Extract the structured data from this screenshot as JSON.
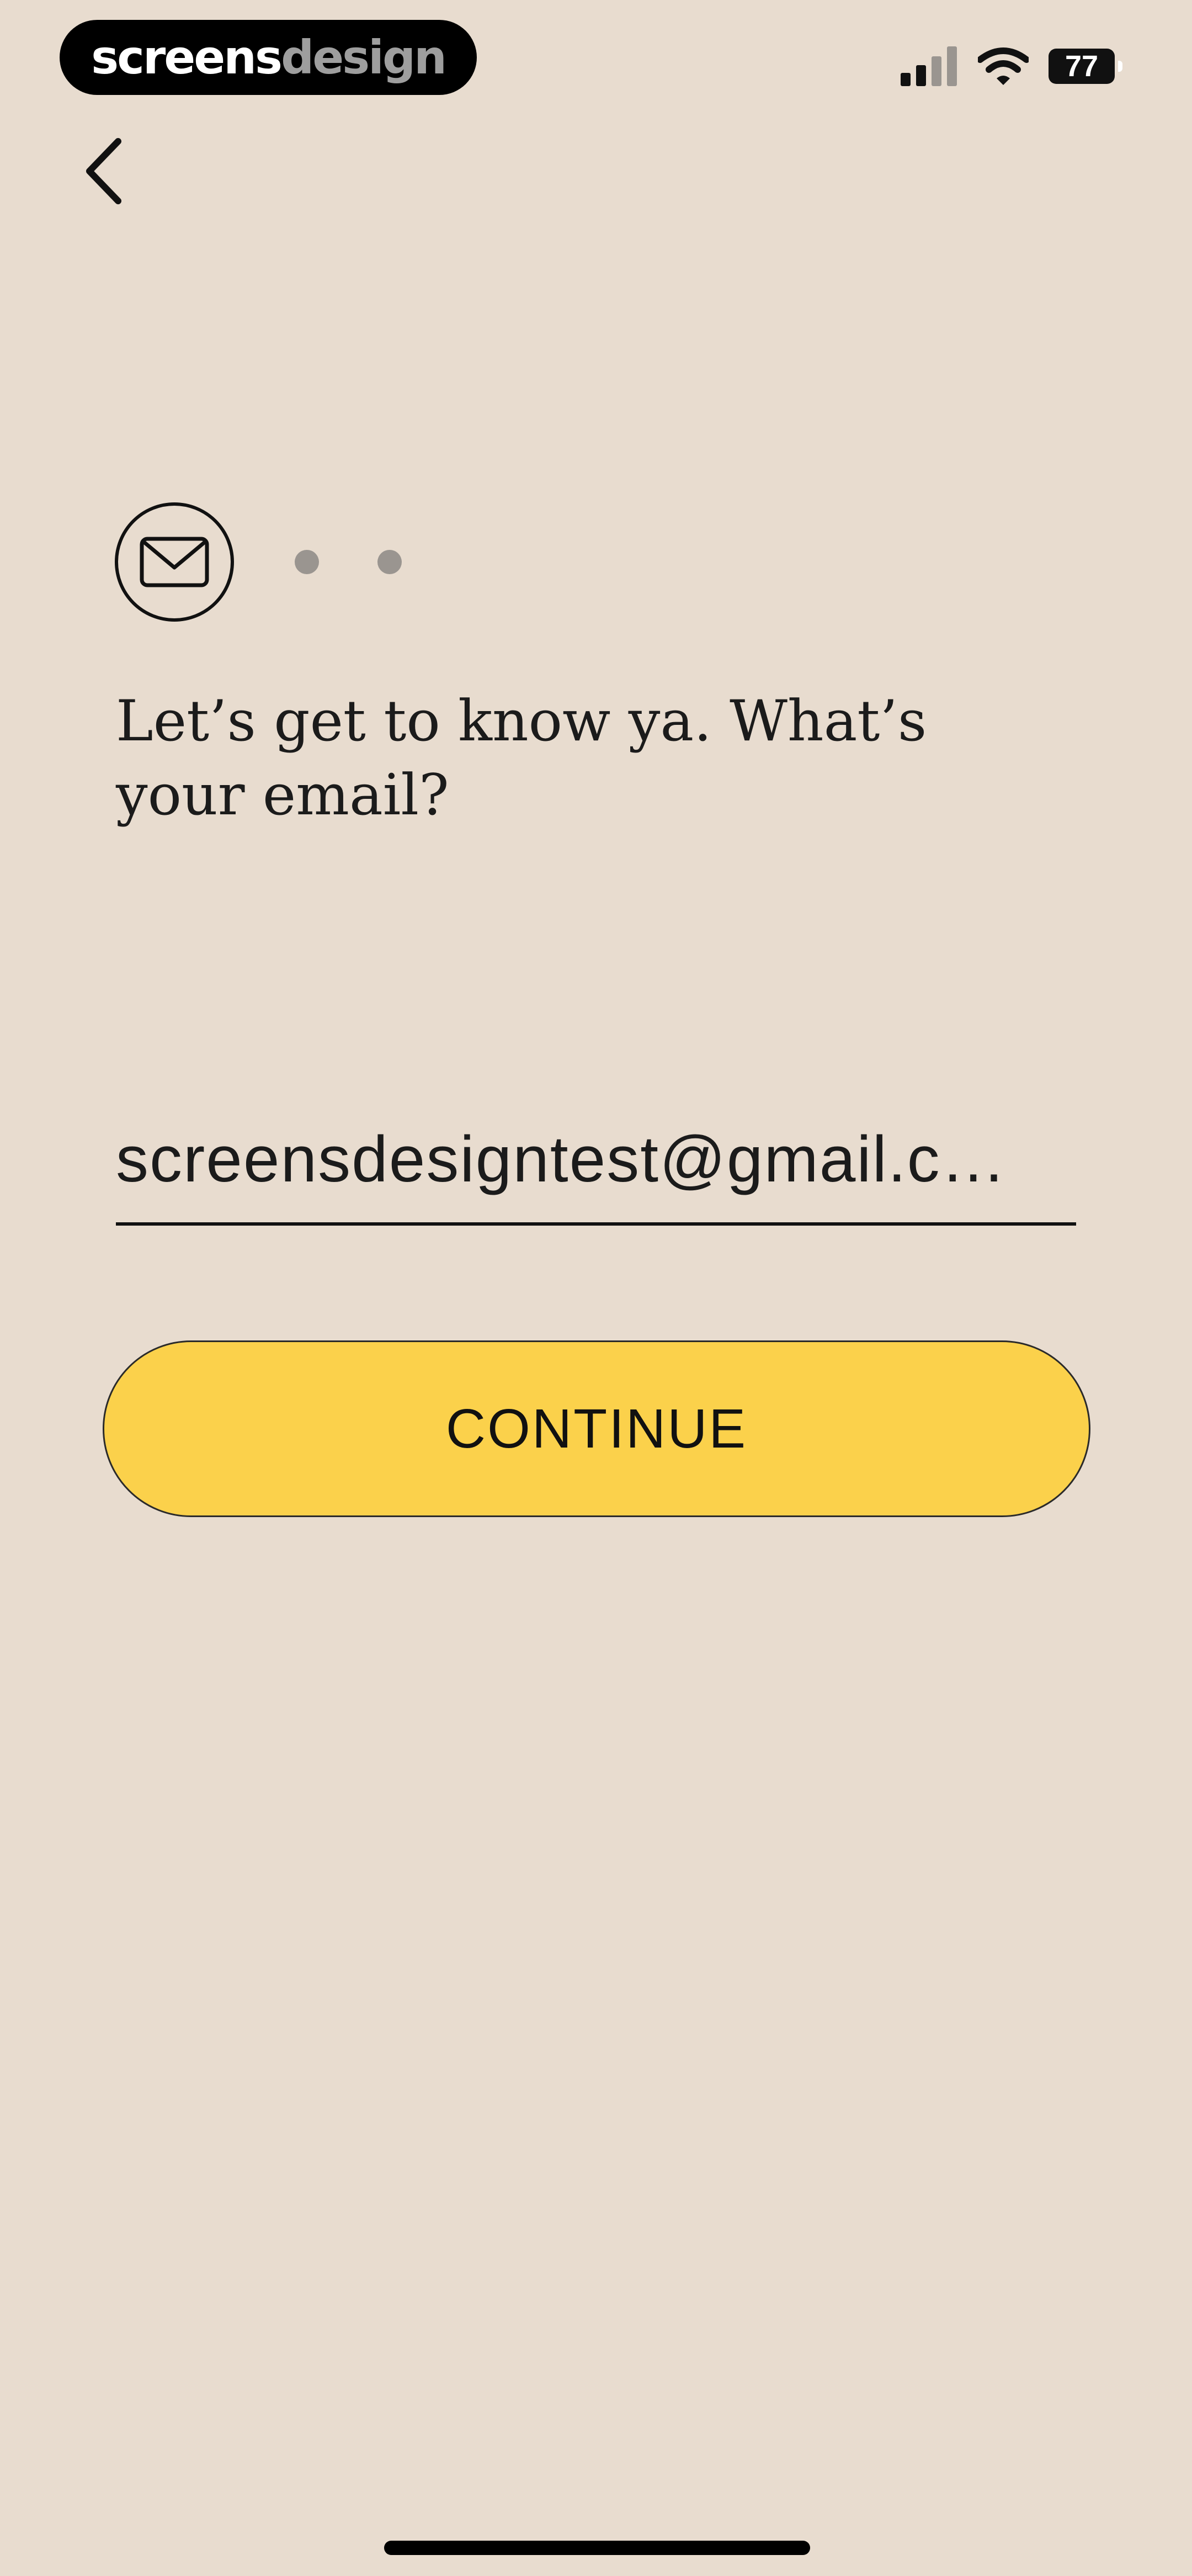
{
  "status_bar": {
    "brand_part1": "screens",
    "brand_part2": "design",
    "battery_level": "77",
    "signal_icon": "signal-icon",
    "wifi_icon": "wifi-icon",
    "battery_icon": "battery-icon"
  },
  "nav": {
    "back_icon": "chevron-left-icon"
  },
  "progress": {
    "current_step_icon": "mail-icon",
    "total_steps": 3,
    "current_step": 1
  },
  "form": {
    "heading_line1": "Let’s get to know ya. What’s",
    "heading_line2": "your email?",
    "email_value": "screensdesigntest@gmail.c…",
    "continue_label": "CONTINUE"
  },
  "colors": {
    "background": "#e8dccf",
    "button": "#fbd14b",
    "text": "#111111"
  }
}
